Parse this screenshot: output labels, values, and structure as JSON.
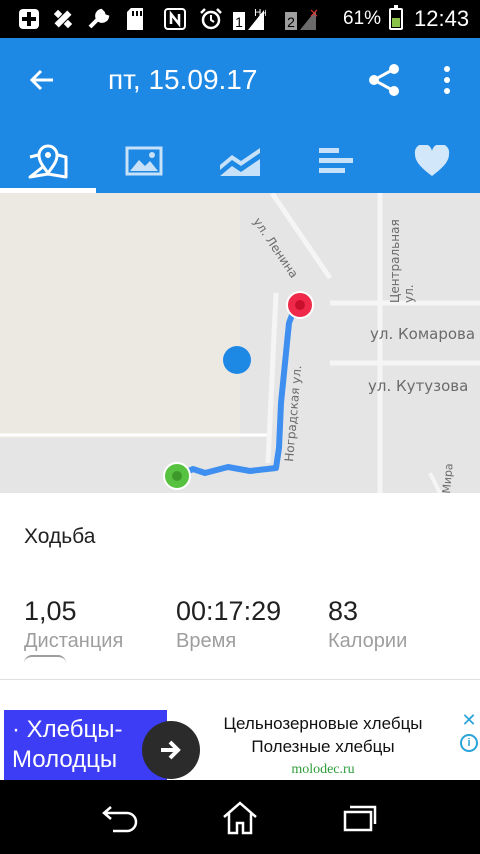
{
  "status_bar": {
    "battery_percent_text": "61%",
    "battery_level": 0.61,
    "time": "12:43",
    "sim1_label": "1",
    "sim2_label": "2",
    "icons": [
      "plus-box-icon",
      "satellite-icon",
      "wrench-icon",
      "sd-card-icon",
      "nfc-icon",
      "alarm-clock-icon",
      "sim-signal-icon",
      "sim-signal-icon",
      "battery-icon"
    ]
  },
  "app_bar": {
    "title": "пт, 15.09.17",
    "back_icon": "arrow-left-icon",
    "share_icon": "share-icon",
    "more_icon": "more-vertical-icon",
    "tabs": [
      {
        "icon": "map-pin-icon",
        "active": true
      },
      {
        "icon": "image-icon",
        "active": false
      },
      {
        "icon": "area-chart-icon",
        "active": false
      },
      {
        "icon": "bars-icon",
        "active": false
      },
      {
        "icon": "heart-icon",
        "active": false
      }
    ],
    "accent_color": "#1e88e5"
  },
  "map": {
    "streets": {
      "lenina": "ул. Ленина",
      "centralnaya": "Центральная ул.",
      "komarova": "ул. Комарова",
      "kutuzova": "ул. Кутузова",
      "nogradskaya": "Ноградская ул.",
      "mira": "Мира"
    },
    "route_color": "#3f8ff0",
    "start_marker_color": "#57c23f",
    "end_marker_color": "#f0294a",
    "position_marker_color": "#1e88e5"
  },
  "workout": {
    "activity": "Ходьба",
    "stats": [
      {
        "value": "1,05",
        "label": "Дистанция"
      },
      {
        "value": "00:17:29",
        "label": "Время"
      },
      {
        "value": "83",
        "label": "Калории"
      }
    ]
  },
  "ad": {
    "brand_line1": "· Хлебцы-",
    "brand_line2": "Молодцы",
    "line1": "Цельнозерновые хлебцы",
    "line2": "Полезные хлебцы",
    "url": "molodec.ru",
    "close_icon": "close-icon",
    "info_icon": "info-icon"
  },
  "nav_bar": {
    "back_icon": "back-icon",
    "home_icon": "home-icon",
    "recents_icon": "recents-icon"
  }
}
